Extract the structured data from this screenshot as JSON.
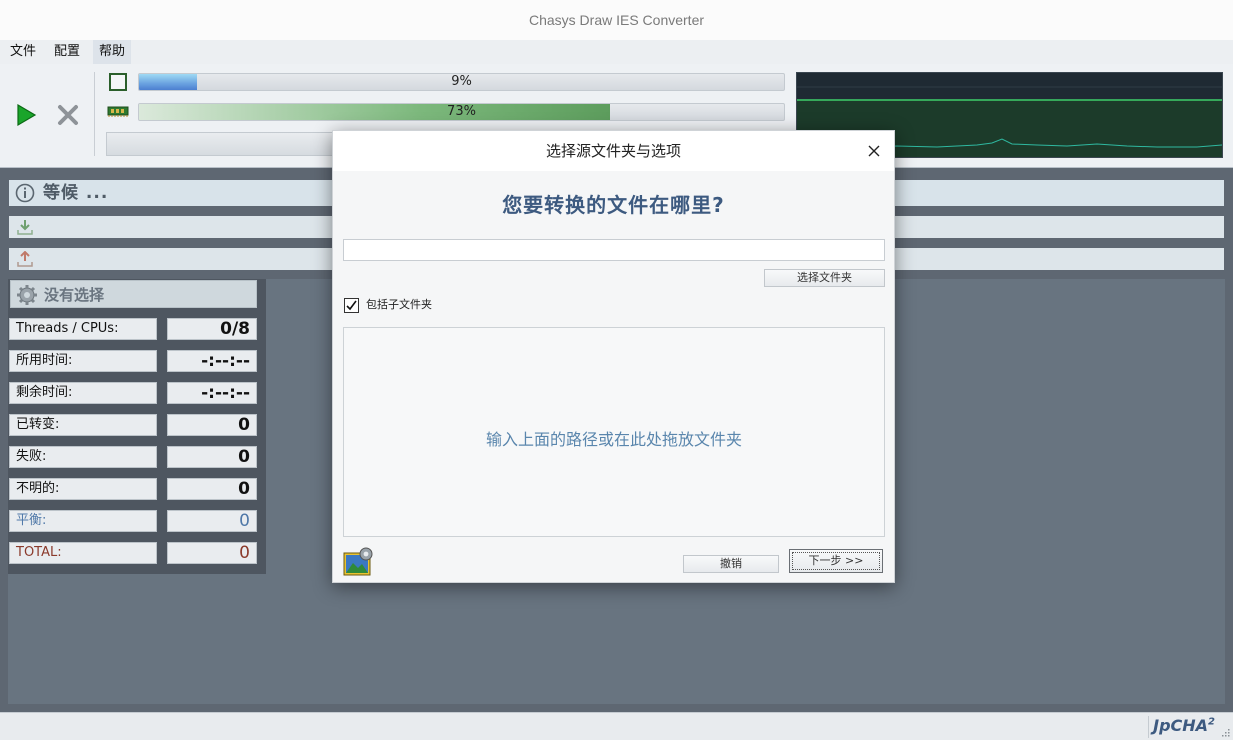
{
  "window": {
    "title": "Chasys Draw IES Converter"
  },
  "menu": {
    "items": [
      "文件",
      "配置",
      "帮助"
    ]
  },
  "toolbar": {
    "start_icon": "play-icon",
    "stop_icon": "close-x-icon"
  },
  "progress": {
    "file_percent_label": "9%",
    "file_fraction": 0.09,
    "memory_percent_label": "73%",
    "memory_fraction": 0.73,
    "file_color": "#6fb3ea",
    "memory_color": "#5a9a5a"
  },
  "graph": {
    "bg_color": "#1f2a33",
    "line_color": "#2ec27e"
  },
  "status": {
    "text": "等候 ..."
  },
  "selection": {
    "title": "没有选择"
  },
  "stats": [
    {
      "label": "Threads / CPUs:",
      "value": "0/8"
    },
    {
      "label": "所用时间:",
      "value": "-:--:--"
    },
    {
      "label": "剩余时间:",
      "value": "-:--:--"
    },
    {
      "label": "已转变:",
      "value": "0"
    },
    {
      "label": "失败:",
      "value": "0"
    },
    {
      "label": "不明的:",
      "value": "0"
    },
    {
      "label": "平衡:",
      "value": "0"
    },
    {
      "label": "TOTAL:",
      "value": "0"
    }
  ],
  "logo": {
    "text": "JpCHA",
    "sup": "2"
  },
  "dialog": {
    "title": "选择源文件夹与选项",
    "heading": "您要转换的文件在哪里?",
    "path_value": "",
    "choose_folder_label": "选择文件夹",
    "include_subfolders_label": "包括子文件夹",
    "include_subfolders_checked": true,
    "drop_hint": "输入上面的路径或在此处拖放文件夹",
    "cancel_label": "撤销",
    "next_label": "下一步 >>"
  }
}
